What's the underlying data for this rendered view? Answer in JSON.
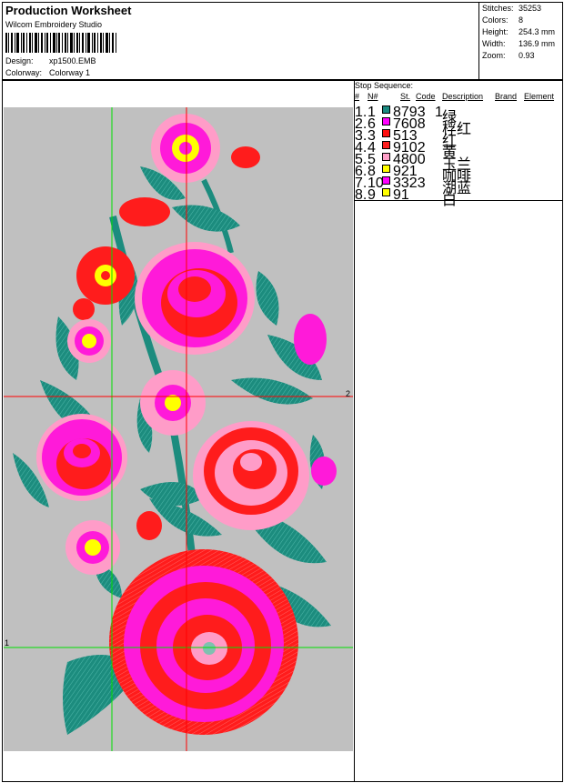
{
  "header": {
    "title": "Production Worksheet",
    "app": "Wilcom Embroidery Studio",
    "design_label": "Design:",
    "design_value": "xp1500.EMB",
    "colorway_label": "Colorway:",
    "colorway_value": "Colorway 1"
  },
  "stats": [
    {
      "label": "Stitches:",
      "value": "35253"
    },
    {
      "label": "Colors:",
      "value": "8"
    },
    {
      "label": "Height:",
      "value": "254.3 mm"
    },
    {
      "label": "Width:",
      "value": "136.9 mm"
    },
    {
      "label": "Zoom:",
      "value": "0.93"
    }
  ],
  "stop_sequence": {
    "title": "Stop Sequence:",
    "headers": {
      "num": "#",
      "n": "N#",
      "st": "St.",
      "code": "Code",
      "description": "Description",
      "brand": "Brand",
      "element": "Element"
    },
    "rows": [
      {
        "num": "1.",
        "n": "1",
        "code": "8793",
        "st": "1",
        "description": "绿",
        "color": "#1a8a80"
      },
      {
        "num": "2.",
        "n": "6",
        "code": "7608",
        "st": "",
        "description": "桴红",
        "color": "#ff00ff"
      },
      {
        "num": "3.",
        "n": "3",
        "code": "513",
        "st": "",
        "description": "红",
        "color": "#ff1010"
      },
      {
        "num": "4.",
        "n": "4",
        "code": "9102",
        "st": "",
        "description": "黄",
        "color": "#ff2020"
      },
      {
        "num": "5.",
        "n": "5",
        "code": "4800",
        "st": "",
        "description": "玉兰",
        "color": "#ff9fc8"
      },
      {
        "num": "6.",
        "n": "8",
        "code": "921",
        "st": "",
        "description": "咖啡",
        "color": "#ffff00"
      },
      {
        "num": "7.",
        "n": "10",
        "code": "3323",
        "st": "",
        "description": "湖蓝",
        "color": "#ff00ff"
      },
      {
        "num": "8.",
        "n": "9",
        "code": "91",
        "st": "",
        "description": "白",
        "color": "#ffff00"
      }
    ]
  },
  "design_view": {
    "guide_labels": [
      "2",
      "1"
    ],
    "colors": {
      "background": "#c0c0c0",
      "leaf": "#1c8c7e",
      "magenta": "#ff1ad9",
      "red": "#ff1c1c",
      "pink": "#ff9cc8",
      "yellow": "#ffff00",
      "guide_green": "#00e000",
      "guide_red": "#ff0000"
    }
  }
}
